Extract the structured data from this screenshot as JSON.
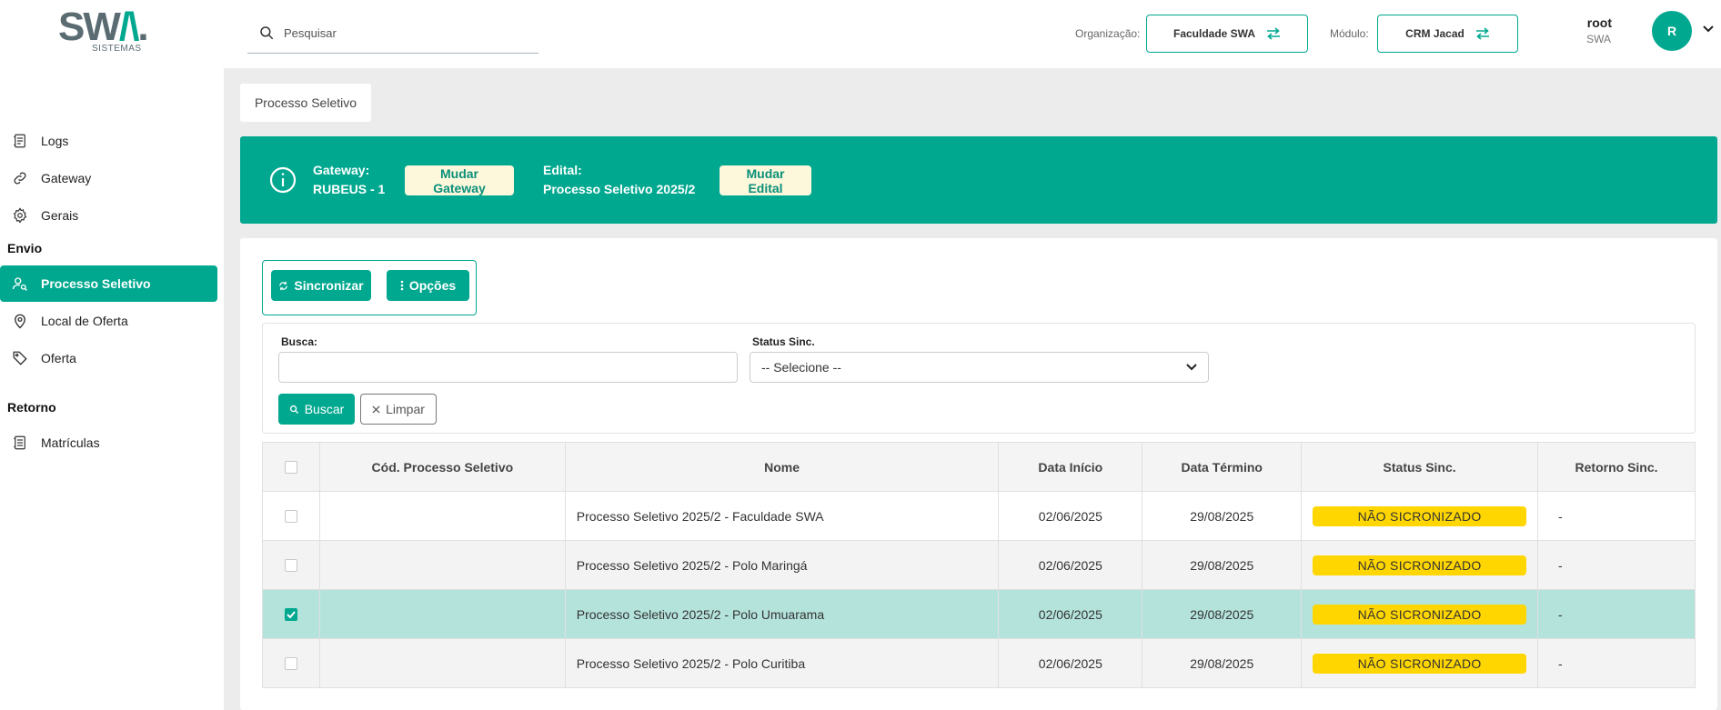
{
  "header": {
    "logo_text": "SWA.",
    "logo_sub": "SISTEMAS",
    "search_placeholder": "Pesquisar",
    "org_label": "Organização:",
    "org_value": "Faculdade SWA",
    "module_label": "Módulo:",
    "module_value": "CRM Jacad",
    "user_name": "root",
    "user_org": "SWA",
    "avatar_initial": "R"
  },
  "sidebar": {
    "items_top": [
      {
        "label": "Logs",
        "icon": "log-icon"
      },
      {
        "label": "Gateway",
        "icon": "link-icon"
      },
      {
        "label": "Gerais",
        "icon": "gear-icon"
      }
    ],
    "section_envio": "Envio",
    "items_envio": [
      {
        "label": "Processo Seletivo",
        "icon": "user-search-icon",
        "active": true
      },
      {
        "label": "Local de Oferta",
        "icon": "map-pin-icon"
      },
      {
        "label": "Oferta",
        "icon": "tag-icon"
      }
    ],
    "section_retorno": "Retorno",
    "items_retorno": [
      {
        "label": "Matrículas",
        "icon": "document-icon"
      }
    ]
  },
  "breadcrumb": "Processo Seletivo",
  "banner": {
    "gateway_label": "Gateway:",
    "gateway_value": "RUBEUS - 1",
    "change_gateway": "Mudar Gateway",
    "edital_label": "Edital:",
    "edital_value": "Processo Seletivo 2025/2",
    "change_edital": "Mudar Edital"
  },
  "toolbar": {
    "sync_label": "Sincronizar",
    "options_label": "Opções"
  },
  "filters": {
    "search_label": "Busca:",
    "search_value": "",
    "status_label": "Status Sinc.",
    "status_selected": "-- Selecione --",
    "search_button": "Buscar",
    "clear_button": "Limpar"
  },
  "table": {
    "columns": [
      "Cód. Processo Seletivo",
      "Nome",
      "Data Início",
      "Data Término",
      "Status Sinc.",
      "Retorno Sinc."
    ],
    "rows": [
      {
        "checked": false,
        "cod": "",
        "nome": "Processo Seletivo 2025/2 - Faculdade SWA",
        "inicio": "02/06/2025",
        "termino": "29/08/2025",
        "status": "NÃO SICRONIZADO",
        "retorno": "-"
      },
      {
        "checked": false,
        "cod": "",
        "nome": "Processo Seletivo 2025/2 - Polo Maringá",
        "inicio": "02/06/2025",
        "termino": "29/08/2025",
        "status": "NÃO SICRONIZADO",
        "retorno": "-"
      },
      {
        "checked": true,
        "cod": "",
        "nome": "Processo Seletivo 2025/2 - Polo Umuarama",
        "inicio": "02/06/2025",
        "termino": "29/08/2025",
        "status": "NÃO SICRONIZADO",
        "retorno": "-"
      },
      {
        "checked": false,
        "cod": "",
        "nome": "Processo Seletivo 2025/2 - Polo Curitiba",
        "inicio": "02/06/2025",
        "termino": "29/08/2025",
        "status": "NÃO SICRONIZADO",
        "retorno": "-"
      }
    ]
  },
  "colors": {
    "primary": "#00a88f",
    "badge": "#ffd600",
    "selected_row": "#b4e3dc"
  }
}
